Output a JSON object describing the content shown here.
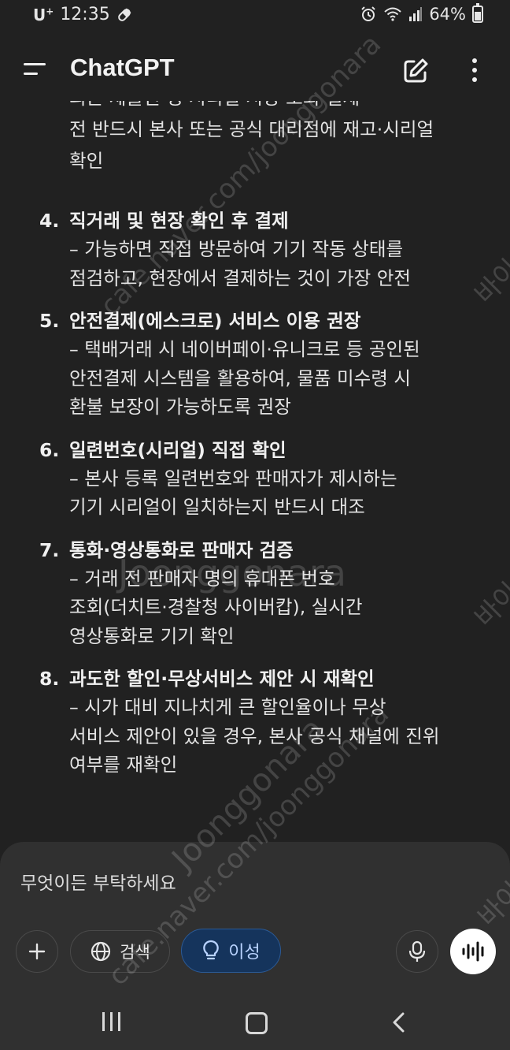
{
  "status_bar": {
    "carrier": "U",
    "carrier_sup": "+",
    "time": "12:35",
    "battery": "64%"
  },
  "header": {
    "title": "ChatGPT"
  },
  "message": {
    "partial_line_cut": "최근 제출된 명·시리얼 시장 조회·결제",
    "partial_lines": [
      "전 반드시 본사 또는 공식 대리점에 재고·시리얼",
      "확인"
    ],
    "items": [
      {
        "num": "4.",
        "title": "직거래 및 현장 확인 후 결제",
        "lines": [
          "– 가능하면 직접 방문하여 기기 작동 상태를",
          "점검하고, 현장에서 결제하는 것이 가장 안전"
        ]
      },
      {
        "num": "5.",
        "title": "안전결제(에스크로) 서비스 이용 권장",
        "lines": [
          "– 택배거래 시 네이버페이·유니크로 등 공인된",
          "안전결제 시스템을 활용하여, 물품 미수령 시",
          "환불 보장이 가능하도록 권장"
        ]
      },
      {
        "num": "6.",
        "title": "일련번호(시리얼) 직접 확인",
        "lines": [
          "– 본사 등록 일련번호와 판매자가 제시하는",
          "기기 시리얼이 일치하는지 반드시 대조"
        ]
      },
      {
        "num": "7.",
        "title": "통화·영상통화로 판매자 검증",
        "lines": [
          "– 거래 전 판매자 명의 휴대폰 번호",
          "조회(더치트·경찰청 사이버캅), 실시간",
          "영상통화로 기기 확인"
        ]
      },
      {
        "num": "8.",
        "title": "과도한 할인·무상서비스 제안 시 재확인",
        "lines": [
          "– 시가 대비 지나치게 큰 할인율이나 무상",
          "서비스 제안이 있을 경우, 본사 공식 채널에 진위",
          "여부를 재확인"
        ]
      }
    ]
  },
  "composer": {
    "placeholder": "무엇이든 부탁하세요",
    "search_label": "검색",
    "reason_label": "이성"
  },
  "watermark": {
    "site": "cafe.naver.com/joonggonara",
    "brand": "Joonggonara",
    "brand_kr": "바이"
  },
  "icons": {
    "menu": "menu-icon",
    "edit": "new-chat-icon",
    "more": "more-vertical-icon",
    "globe": "globe-icon",
    "bulb": "lightbulb-icon",
    "mic": "microphone-icon",
    "voice": "voice-waveform-icon"
  }
}
